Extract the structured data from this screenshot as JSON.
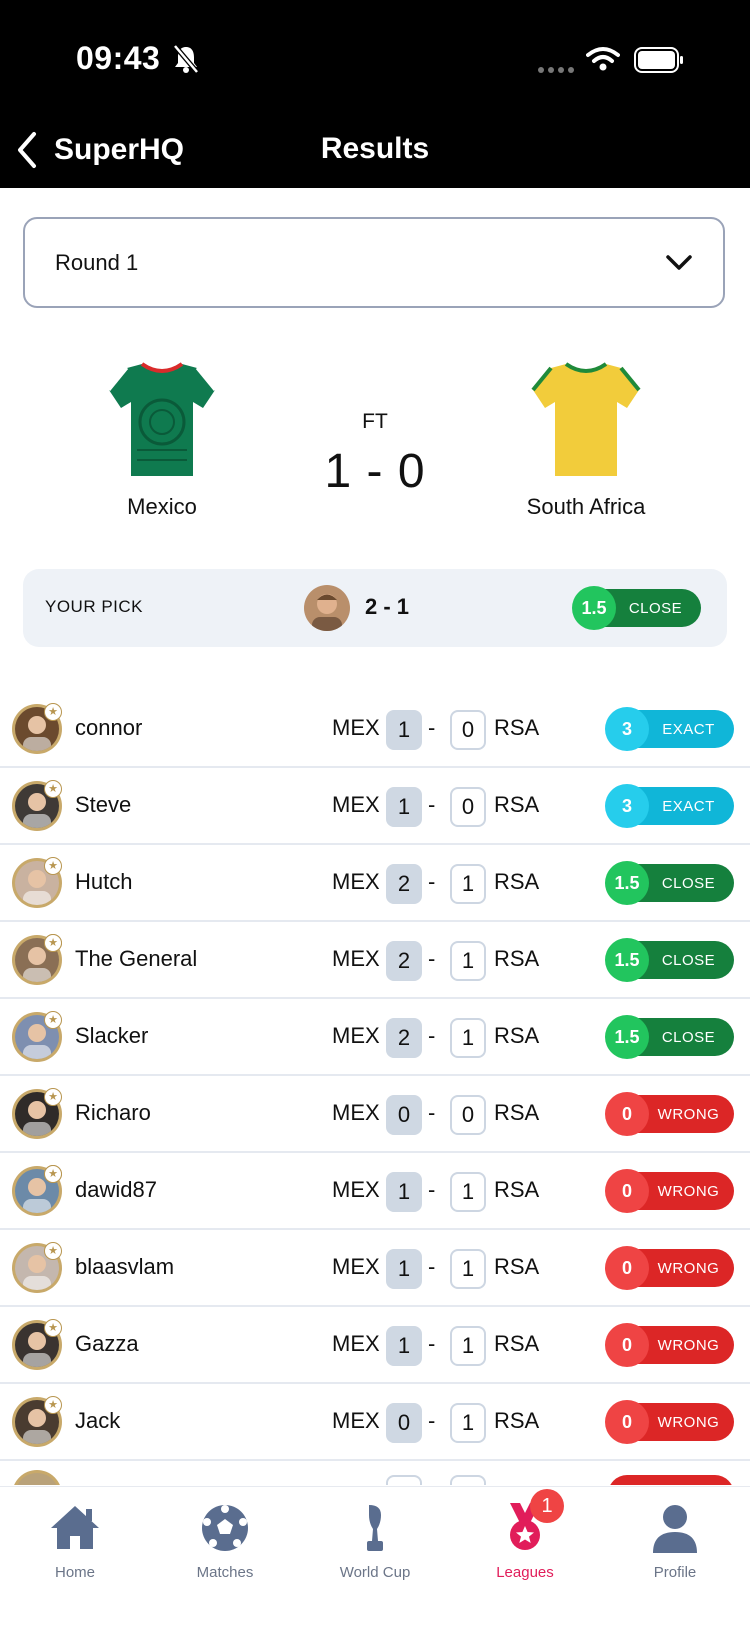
{
  "status_bar": {
    "time": "09:43"
  },
  "nav": {
    "back_label": "SuperHQ",
    "title": "Results"
  },
  "round_select": {
    "value": "Round 1"
  },
  "match": {
    "home_team": "Mexico",
    "away_team": "South Africa",
    "status": "FT",
    "score": "1 - 0",
    "home_jersey_color": "#0f7a4f",
    "away_jersey_color": "#f2cc3b"
  },
  "your_pick": {
    "label": "YOUR PICK",
    "score": "2 - 1",
    "points": "1.5",
    "result": "CLOSE"
  },
  "predictions": [
    {
      "user": "connor",
      "home": "MEX",
      "away": "RSA",
      "h": "1",
      "a": "0",
      "points": "3",
      "result": "EXACT",
      "type": "exact",
      "gold": true
    },
    {
      "user": "Steve",
      "home": "MEX",
      "away": "RSA",
      "h": "1",
      "a": "0",
      "points": "3",
      "result": "EXACT",
      "type": "exact",
      "gold": false
    },
    {
      "user": "Hutch",
      "home": "MEX",
      "away": "RSA",
      "h": "2",
      "a": "1",
      "points": "1.5",
      "result": "CLOSE",
      "type": "close",
      "gold": false
    },
    {
      "user": "The General",
      "home": "MEX",
      "away": "RSA",
      "h": "2",
      "a": "1",
      "points": "1.5",
      "result": "CLOSE",
      "type": "close",
      "gold": true
    },
    {
      "user": "Slacker",
      "home": "MEX",
      "away": "RSA",
      "h": "2",
      "a": "1",
      "points": "1.5",
      "result": "CLOSE",
      "type": "close",
      "gold": false
    },
    {
      "user": "Richaro",
      "home": "MEX",
      "away": "RSA",
      "h": "0",
      "a": "0",
      "points": "0",
      "result": "WRONG",
      "type": "wrong",
      "gold": false
    },
    {
      "user": "dawid87",
      "home": "MEX",
      "away": "RSA",
      "h": "1",
      "a": "1",
      "points": "0",
      "result": "WRONG",
      "type": "wrong",
      "gold": true
    },
    {
      "user": "blaasvlam",
      "home": "MEX",
      "away": "RSA",
      "h": "1",
      "a": "1",
      "points": "0",
      "result": "WRONG",
      "type": "wrong",
      "gold": false
    },
    {
      "user": "Gazza",
      "home": "MEX",
      "away": "RSA",
      "h": "1",
      "a": "1",
      "points": "0",
      "result": "WRONG",
      "type": "wrong",
      "gold": false
    },
    {
      "user": "Jack",
      "home": "MEX",
      "away": "RSA",
      "h": "0",
      "a": "1",
      "points": "0",
      "result": "WRONG",
      "type": "wrong",
      "gold": false
    }
  ],
  "tabs": [
    {
      "label": "Home",
      "icon": "home-icon"
    },
    {
      "label": "Matches",
      "icon": "soccer-ball-icon"
    },
    {
      "label": "World Cup",
      "icon": "trophy-icon"
    },
    {
      "label": "Leagues",
      "icon": "medal-icon",
      "active": true,
      "badge": "1"
    },
    {
      "label": "Profile",
      "icon": "person-icon"
    }
  ],
  "colors": {
    "exact": "#10b6d8",
    "close": "#15803d",
    "wrong": "#dc2626",
    "active_tab": "#e11d5a",
    "tab_icon": "#5a6d8f"
  }
}
